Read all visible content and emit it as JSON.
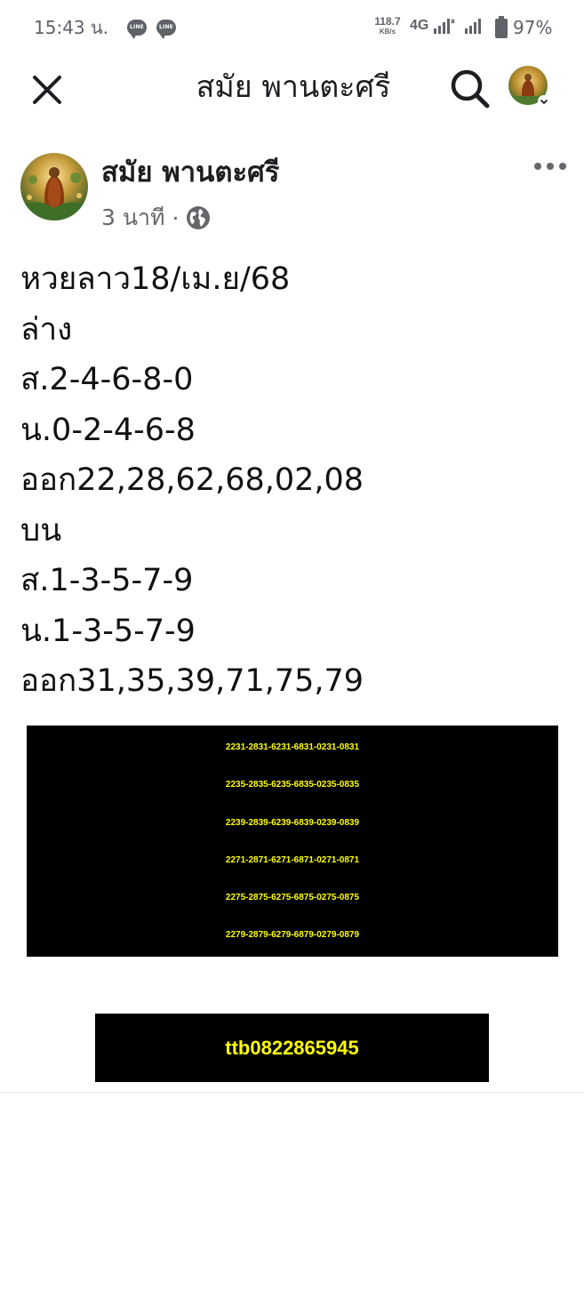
{
  "status_bar": {
    "time": "15:43 น.",
    "notification_icons": [
      "LINE",
      "LINE"
    ],
    "net_speed_value": "118.7",
    "net_speed_unit": "KB/s",
    "network_type": "4G",
    "battery_percent": "97%",
    "icons": [
      "line-notification-icon",
      "line-notification-icon",
      "signal-icon",
      "signal-icon",
      "battery-icon"
    ]
  },
  "header": {
    "title": "สมัย พานตะศรี",
    "icons": [
      "close-icon",
      "search-icon",
      "profile-avatar",
      "chevron-down-icon"
    ]
  },
  "post": {
    "author": "สมัย พานตะศรี",
    "time_ago": "3 นาที",
    "separator": "·",
    "privacy_icon": "globe-icon",
    "lines": [
      "หวยลาว18/เม.ย/68",
      "ล่าง",
      "ส.2-4-6-8-0",
      "น.0-2-4-6-8",
      "ออก22,28,62,68,02,08",
      "บน",
      "ส.1-3-5-7-9",
      "น.1-3-5-7-9",
      "ออก31,35,39,71,75,79"
    ],
    "image": {
      "background_color": "#000000",
      "text_color": "#ffff00",
      "number_rows": [
        "2231-2831-6231-6831-0231-0831",
        "2235-2835-6235-6835-0235-0835",
        "2239-2839-6239-6839-0239-0839",
        "2271-2871-6271-6871-0271-0871",
        "2275-2875-6275-6875-0275-0875",
        "2279-2879-6279-6879-0279-0879"
      ],
      "account": "ttb0822865945"
    }
  }
}
